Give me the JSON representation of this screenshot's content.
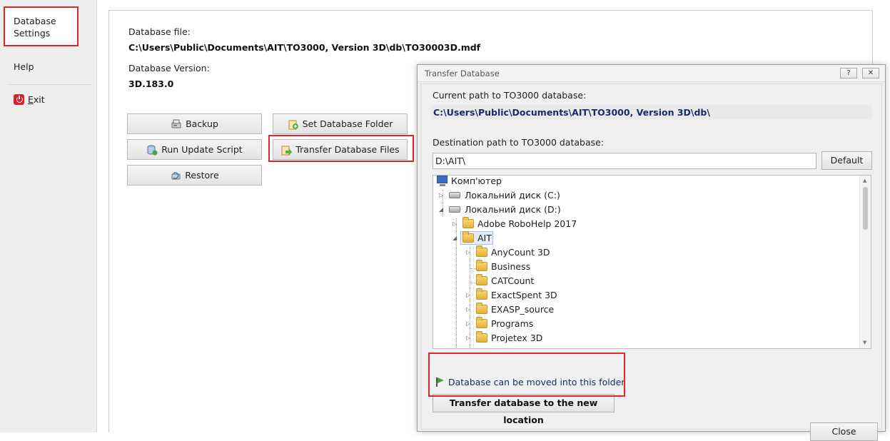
{
  "sidebar": {
    "items": [
      {
        "label": "Database\nSettings"
      },
      {
        "label": "Help"
      },
      {
        "label": "Exit",
        "accesskey": "E",
        "rest": "xit"
      }
    ]
  },
  "main": {
    "db_file_label": "Database file:",
    "db_file_value": "C:\\Users\\Public\\Documents\\AIT\\TO3000, Version 3D\\db\\TO30003D.mdf",
    "db_version_label": "Database Version:",
    "db_version_value": "3D.183.0",
    "buttons": {
      "backup": "Backup",
      "run_update_script": "Run Update Script",
      "restore": "Restore",
      "set_database_folder": "Set Database Folder",
      "transfer_database_files": "Transfer Database Files"
    }
  },
  "dialog": {
    "title": "Transfer Database",
    "help_btn": "?",
    "close_x": "✕",
    "current_path_label": "Current path to TO3000 database:",
    "current_path_value": "C:\\Users\\Public\\Documents\\AIT\\TO3000, Version 3D\\db\\",
    "destination_label": "Destination path to TO3000 database:",
    "destination_value": "D:\\AIT\\",
    "default_btn": "Default",
    "tree": {
      "computer": "Комп'ютер",
      "drive_c": "Локальний диск (C:)",
      "drive_d": "Локальний диск (D:)",
      "adobe": "Adobe RoboHelp 2017",
      "ait": "AIT",
      "children": [
        "AnyCount 3D",
        "Business",
        "CATCount",
        "ExactSpent 3D",
        "EXASP_source",
        "Programs",
        "Projetex 3D"
      ]
    },
    "status": "Database can be moved into this folder",
    "transfer_btn": "Transfer database to the new location",
    "close_btn": "Close"
  },
  "colors": {
    "highlight_red": "#e0262b",
    "path_blue": "#1a2a6c",
    "flag_green": "#3aa33a"
  }
}
